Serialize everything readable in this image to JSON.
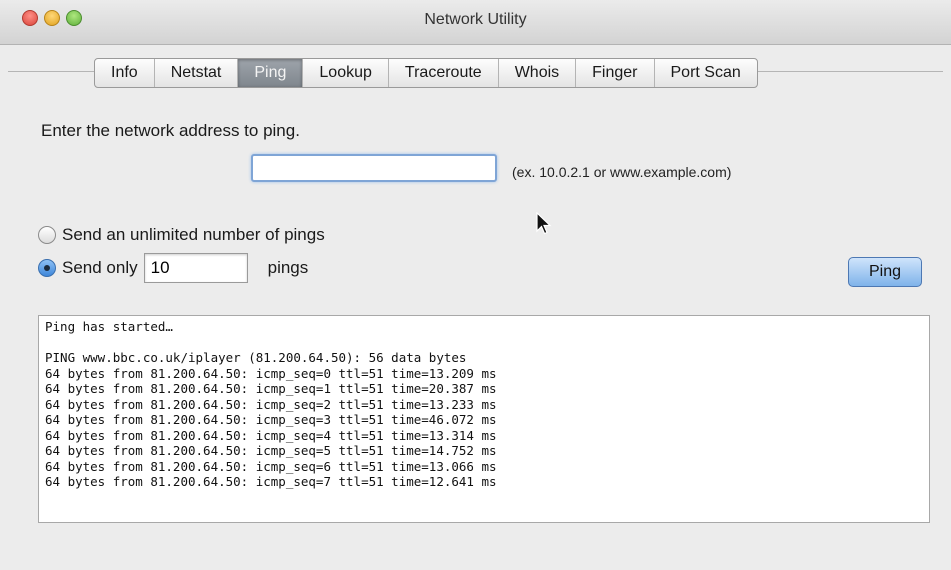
{
  "window": {
    "title": "Network Utility"
  },
  "tabs": [
    {
      "label": "Info"
    },
    {
      "label": "Netstat"
    },
    {
      "label": "Ping"
    },
    {
      "label": "Lookup"
    },
    {
      "label": "Traceroute"
    },
    {
      "label": "Whois"
    },
    {
      "label": "Finger"
    },
    {
      "label": "Port Scan"
    }
  ],
  "active_tab": "Ping",
  "form": {
    "prompt": "Enter the network address to ping.",
    "address_value": "",
    "address_hint": "(ex. 10.0.2.1 or www.example.com)",
    "option_unlimited": "Send an unlimited number of pings",
    "option_only": "Send only",
    "ping_count": "10",
    "pings_suffix": "pings",
    "selected_option": "only"
  },
  "ping_button": "Ping",
  "output": {
    "status": "Ping has started…",
    "header": "PING www.bbc.co.uk/iplayer (81.200.64.50): 56 data bytes",
    "lines": [
      "64 bytes from 81.200.64.50: icmp_seq=0 ttl=51 time=13.209 ms",
      "64 bytes from 81.200.64.50: icmp_seq=1 ttl=51 time=20.387 ms",
      "64 bytes from 81.200.64.50: icmp_seq=2 ttl=51 time=13.233 ms",
      "64 bytes from 81.200.64.50: icmp_seq=3 ttl=51 time=46.072 ms",
      "64 bytes from 81.200.64.50: icmp_seq=4 ttl=51 time=13.314 ms",
      "64 bytes from 81.200.64.50: icmp_seq=5 ttl=51 time=14.752 ms",
      "64 bytes from 81.200.64.50: icmp_seq=6 ttl=51 time=13.066 ms",
      "64 bytes from 81.200.64.50: icmp_seq=7 ttl=51 time=12.641 ms"
    ]
  },
  "colors": {
    "active_tab": "#8a9097",
    "ping_button": "#7fb3ea",
    "focus_ring": "#7fa5d6"
  }
}
